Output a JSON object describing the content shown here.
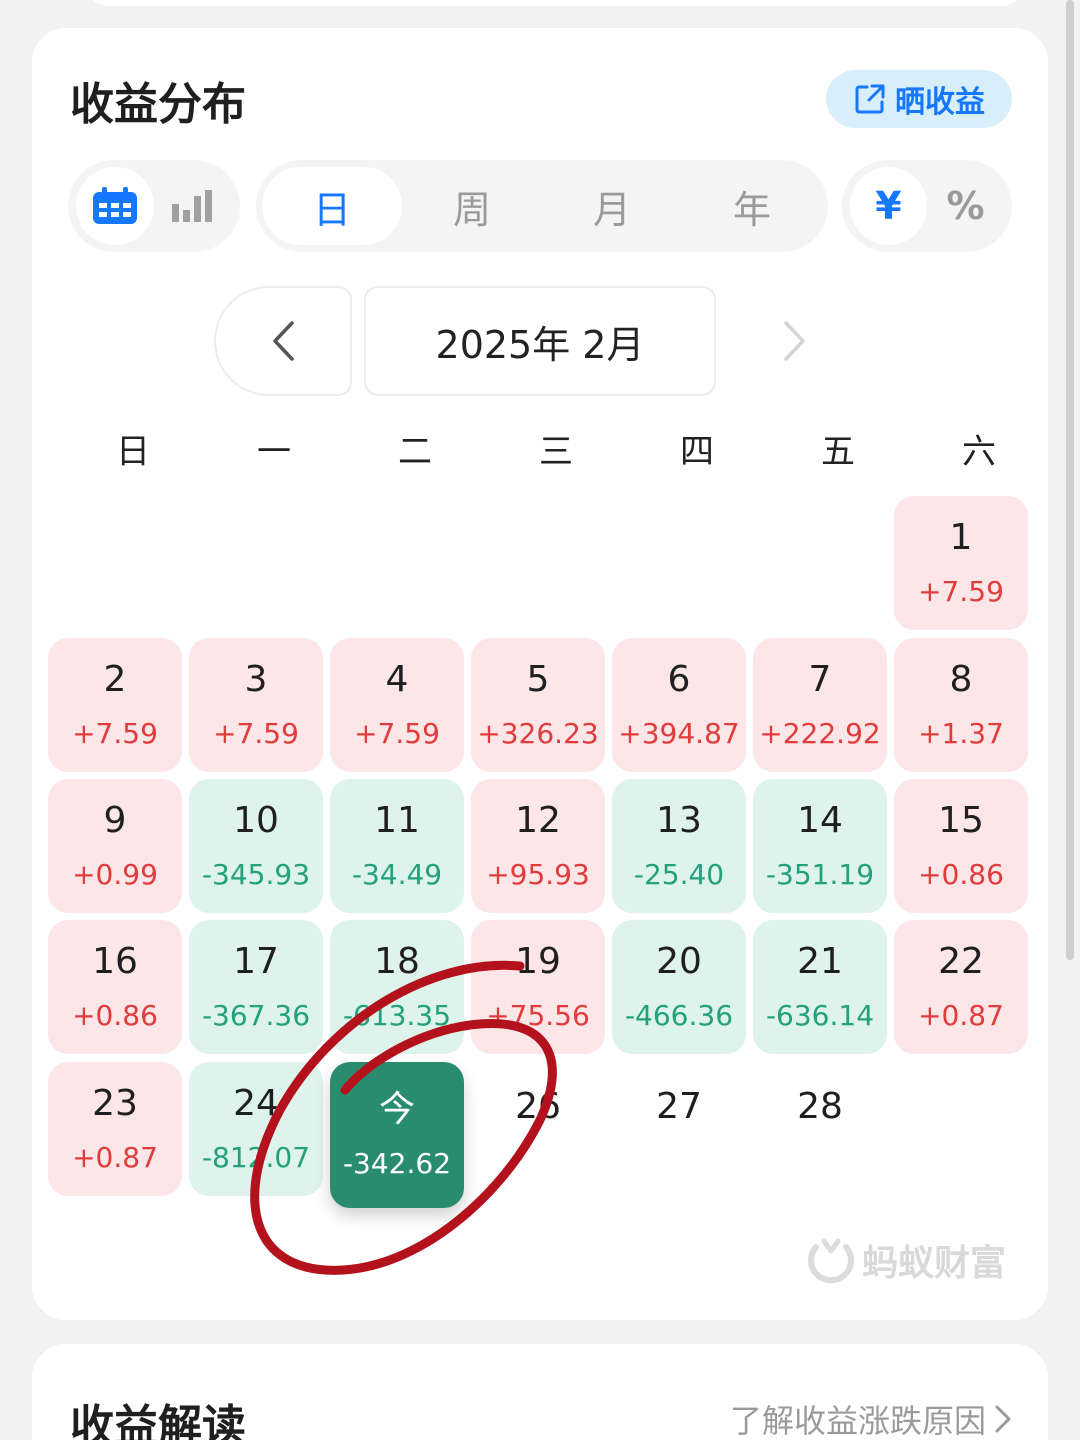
{
  "card": {
    "title": "收益分布",
    "share_label": "晒收益"
  },
  "toggles": {
    "view": [
      {
        "icon": "calendar-icon",
        "active": true
      },
      {
        "icon": "bar-chart-icon",
        "active": false
      }
    ],
    "period": [
      {
        "label": "日",
        "active": true
      },
      {
        "label": "周",
        "active": false
      },
      {
        "label": "月",
        "active": false
      },
      {
        "label": "年",
        "active": false
      }
    ],
    "unit": [
      {
        "label": "¥",
        "active": true
      },
      {
        "label": "%",
        "active": false
      }
    ]
  },
  "month": {
    "label": "2025年 2月"
  },
  "weekdays": [
    "日",
    "一",
    "二",
    "三",
    "四",
    "五",
    "六"
  ],
  "days": [
    {
      "day": "1",
      "value": "+7.59",
      "type": "pos"
    },
    {
      "day": "2",
      "value": "+7.59",
      "type": "pos"
    },
    {
      "day": "3",
      "value": "+7.59",
      "type": "pos"
    },
    {
      "day": "4",
      "value": "+7.59",
      "type": "pos"
    },
    {
      "day": "5",
      "value": "+326.23",
      "type": "pos"
    },
    {
      "day": "6",
      "value": "+394.87",
      "type": "pos"
    },
    {
      "day": "7",
      "value": "+222.92",
      "type": "pos"
    },
    {
      "day": "8",
      "value": "+1.37",
      "type": "pos"
    },
    {
      "day": "9",
      "value": "+0.99",
      "type": "pos"
    },
    {
      "day": "10",
      "value": "-345.93",
      "type": "neg"
    },
    {
      "day": "11",
      "value": "-34.49",
      "type": "neg"
    },
    {
      "day": "12",
      "value": "+95.93",
      "type": "pos"
    },
    {
      "day": "13",
      "value": "-25.40",
      "type": "neg"
    },
    {
      "day": "14",
      "value": "-351.19",
      "type": "neg"
    },
    {
      "day": "15",
      "value": "+0.86",
      "type": "pos"
    },
    {
      "day": "16",
      "value": "+0.86",
      "type": "pos"
    },
    {
      "day": "17",
      "value": "-367.36",
      "type": "neg"
    },
    {
      "day": "18",
      "value": "-613.35",
      "type": "neg"
    },
    {
      "day": "19",
      "value": "+75.56",
      "type": "pos"
    },
    {
      "day": "20",
      "value": "-466.36",
      "type": "neg"
    },
    {
      "day": "21",
      "value": "-636.14",
      "type": "neg"
    },
    {
      "day": "22",
      "value": "+0.87",
      "type": "pos"
    },
    {
      "day": "23",
      "value": "+0.87",
      "type": "pos"
    },
    {
      "day": "24",
      "value": "-812.07",
      "type": "neg"
    },
    {
      "day": "今",
      "value": "-342.62",
      "type": "today"
    },
    {
      "day": "26",
      "value": "",
      "type": "none"
    },
    {
      "day": "27",
      "value": "",
      "type": "none"
    },
    {
      "day": "28",
      "value": "",
      "type": "none"
    }
  ],
  "watermark": "蚂蚁财富",
  "section2": {
    "title": "收益解读",
    "link": "了解收益涨跌原因"
  },
  "colors": {
    "accent": "#1677ff",
    "positive": "#e23b3b",
    "negative": "#22a17a",
    "positive_bg": "#fce6e8",
    "negative_bg": "#ddf3ec",
    "today_bg": "#2a8c6f",
    "annotation": "#b3121c"
  }
}
